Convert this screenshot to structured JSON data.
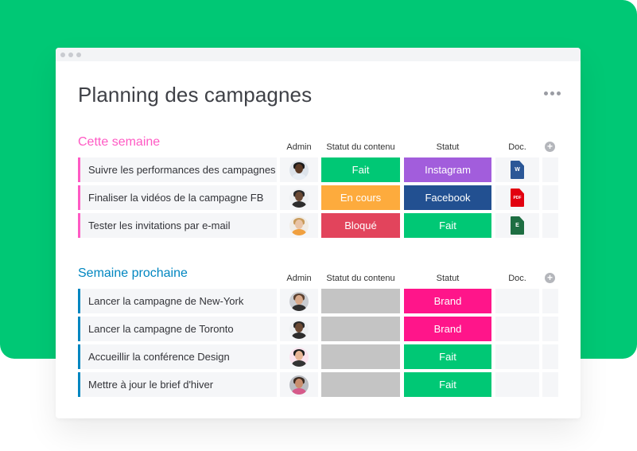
{
  "window": {
    "title": "Planning des campagnes",
    "more_icon": "more-horizontal-icon"
  },
  "colors": {
    "backdrop": "#00c875",
    "group1_accent": "#ff5ac4",
    "group2_accent": "#0086c0"
  },
  "columns": {
    "admin": "Admin",
    "content_status": "Statut du contenu",
    "status": "Statut",
    "doc": "Doc.",
    "add_icon": "plus-circle-icon",
    "add_symbol": "+"
  },
  "groups": [
    {
      "title": "Cette semaine",
      "color": "#ff5ac4",
      "rows": [
        {
          "name": "Suivre les performances des campagnes",
          "admin": "avatar-woman-curly-hair",
          "content_status": {
            "label": "Fait",
            "color": "#00c875"
          },
          "status": {
            "label": "Instagram",
            "color": "#a25ddc"
          },
          "doc": {
            "type": "word-doc-icon",
            "label": "W",
            "color": "#2b5797"
          }
        },
        {
          "name": "Finaliser la vidéos de la campagne FB",
          "admin": "avatar-man-beard",
          "content_status": {
            "label": "En cours",
            "color": "#fdab3d"
          },
          "status": {
            "label": "Facebook",
            "color": "#225091"
          },
          "doc": {
            "type": "pdf-doc-icon",
            "label": "PDF",
            "color": "#e2000f"
          }
        },
        {
          "name": "Tester les invitations par e-mail",
          "admin": "avatar-woman-blonde",
          "content_status": {
            "label": "Bloqué",
            "color": "#e2445c"
          },
          "status": {
            "label": "Fait",
            "color": "#00c875"
          },
          "doc": {
            "type": "excel-doc-icon",
            "label": "E",
            "color": "#1e6e42"
          }
        }
      ]
    },
    {
      "title": "Semaine prochaine",
      "color": "#0086c0",
      "rows": [
        {
          "name": "Lancer la campagne de New-York",
          "admin": "avatar-man-short-hair",
          "content_status": {
            "label": "",
            "color": "#c4c4c4"
          },
          "status": {
            "label": "Brand",
            "color": "#ff158a"
          },
          "doc": null
        },
        {
          "name": "Lancer la campagne de Toronto",
          "admin": "avatar-man-beard",
          "content_status": {
            "label": "",
            "color": "#c4c4c4"
          },
          "status": {
            "label": "Brand",
            "color": "#ff158a"
          },
          "doc": null
        },
        {
          "name": "Accueillir la conférence Design",
          "admin": "avatar-woman-dark-hair",
          "content_status": {
            "label": "",
            "color": "#c4c4c4"
          },
          "status": {
            "label": "Fait",
            "color": "#00c875"
          },
          "doc": null
        },
        {
          "name": "Mettre à jour le brief d'hiver",
          "admin": "avatar-man-glasses",
          "content_status": {
            "label": "",
            "color": "#c4c4c4"
          },
          "status": {
            "label": "Fait",
            "color": "#00c875"
          },
          "doc": null
        }
      ]
    }
  ]
}
